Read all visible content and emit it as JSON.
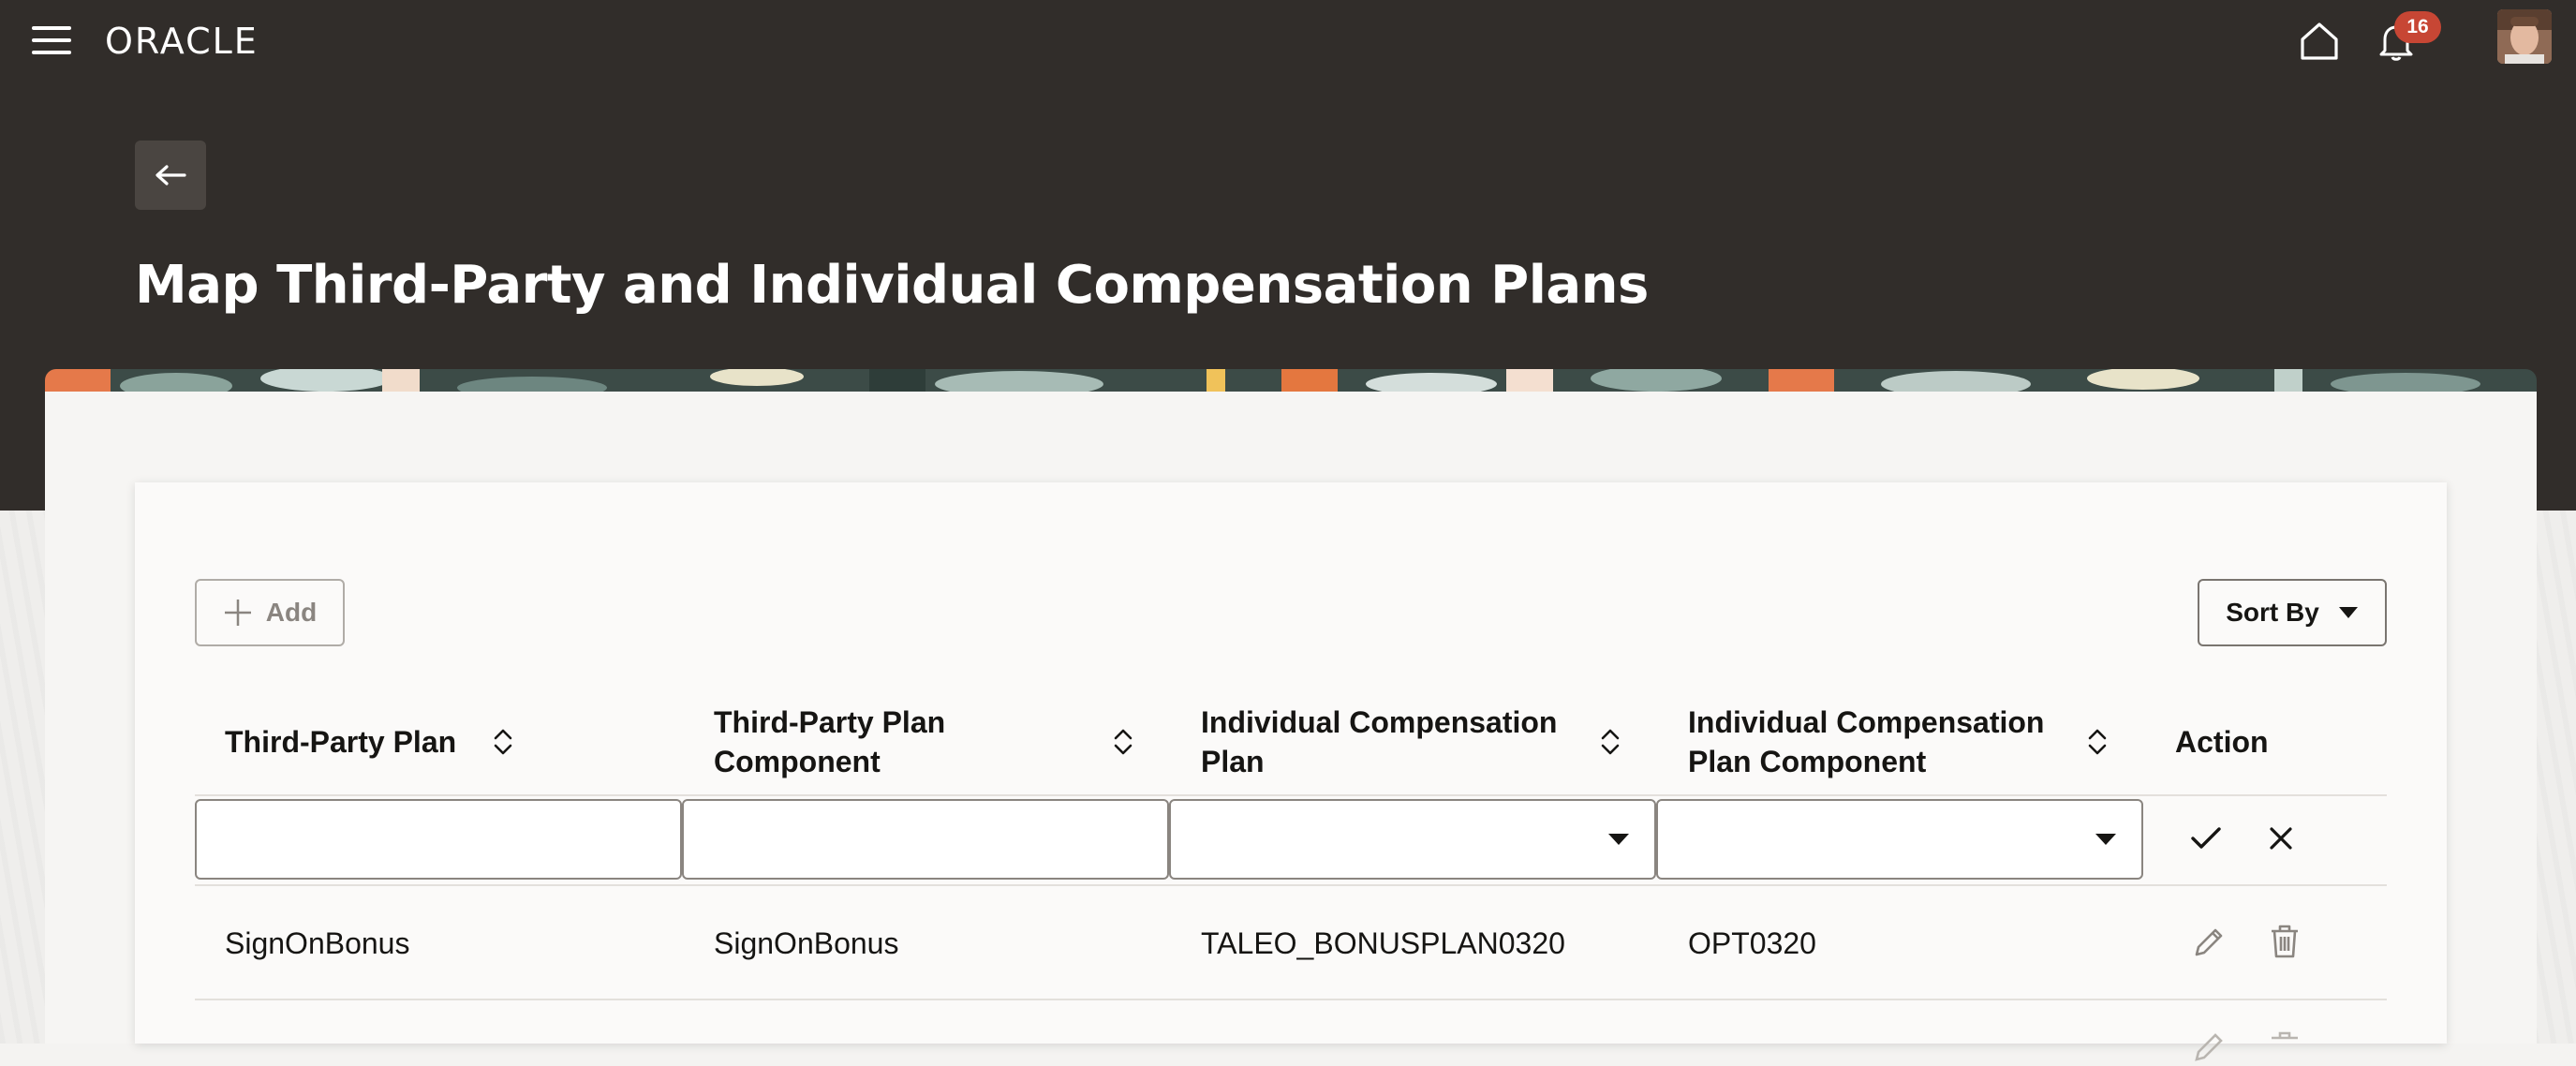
{
  "header": {
    "brand": "ORACLE",
    "notification_count": "16"
  },
  "page": {
    "title": "Map Third-Party and Individual Compensation Plans"
  },
  "toolbar": {
    "add_label": "Add",
    "sort_label": "Sort By"
  },
  "table": {
    "columns": [
      "Third-Party Plan",
      "Third-Party Plan Component",
      "Individual Compensation Plan",
      "Individual Compensation Plan Component",
      "Action"
    ],
    "new_row": {
      "third_party_plan": "",
      "third_party_plan_component": "",
      "individual_compensation_plan": "",
      "individual_compensation_plan_component": ""
    },
    "rows": [
      {
        "third_party_plan": "SignOnBonus",
        "third_party_plan_component": "SignOnBonus",
        "individual_compensation_plan": "TALEO_BONUSPLAN0320",
        "individual_compensation_plan_component": "OPT0320"
      }
    ]
  },
  "icons": {
    "menu": "hamburger-icon",
    "home": "home-icon",
    "notifications": "bell-icon",
    "back": "arrow-left-icon",
    "add": "plus-icon",
    "sort": "caret-down-icon",
    "column_sort": "sort-arrows-icon",
    "confirm": "check-icon",
    "cancel": "close-icon",
    "edit": "pencil-icon",
    "delete": "trash-icon"
  },
  "colors": {
    "header_bg": "#312d2a",
    "badge": "#c74634",
    "card_bg": "#fbfaf9"
  }
}
